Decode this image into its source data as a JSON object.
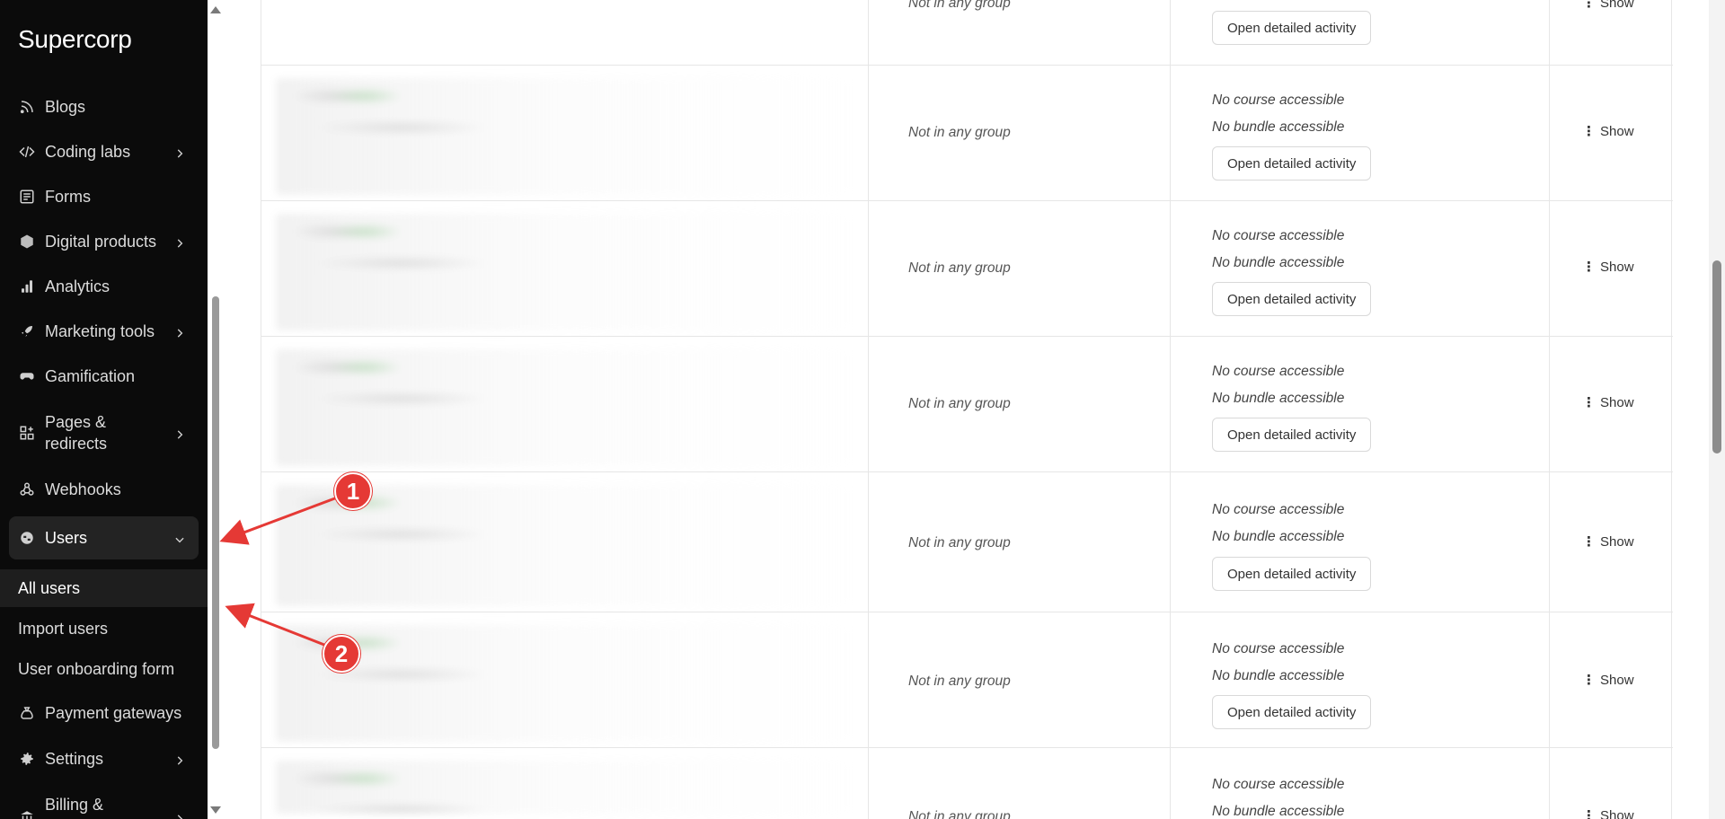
{
  "sidebar": {
    "brand": "Supercorp",
    "items": [
      {
        "label": "Blogs",
        "icon": "rss-icon",
        "has_chevron": false
      },
      {
        "label": "Coding labs",
        "icon": "code-icon",
        "has_chevron": true
      },
      {
        "label": "Forms",
        "icon": "form-icon",
        "has_chevron": false
      },
      {
        "label": "Digital products",
        "icon": "box-icon",
        "has_chevron": true
      },
      {
        "label": "Analytics",
        "icon": "bar-chart-icon",
        "has_chevron": false
      },
      {
        "label": "Marketing tools",
        "icon": "rocket-icon",
        "has_chevron": true
      },
      {
        "label": "Gamification",
        "icon": "gamepad-icon",
        "has_chevron": false
      },
      {
        "label": "Pages & redirects",
        "icon": "grid-plus-icon",
        "has_chevron": true
      },
      {
        "label": "Webhooks",
        "icon": "webhook-icon",
        "has_chevron": false
      },
      {
        "label": "Users",
        "icon": "users-globe-icon",
        "has_chevron": true,
        "expanded": true
      }
    ],
    "users_sub": [
      "All users",
      "Import users",
      "User onboarding form"
    ],
    "after_items": [
      {
        "label": "Payment gateways",
        "icon": "money-bag-icon",
        "has_chevron": false
      },
      {
        "label": "Settings",
        "icon": "gear-icon",
        "has_chevron": true
      },
      {
        "label": "Billing &",
        "icon": "bank-icon",
        "has_chevron": true
      }
    ]
  },
  "table": {
    "rows": [
      {
        "group": "Not in any group",
        "course": "",
        "bundle": "",
        "activity_button": "Open detailed activity",
        "action": "Show"
      },
      {
        "group": "Not in any group",
        "course": "No course accessible",
        "bundle": "No bundle accessible",
        "activity_button": "Open detailed activity",
        "action": "Show"
      },
      {
        "group": "Not in any group",
        "course": "No course accessible",
        "bundle": "No bundle accessible",
        "activity_button": "Open detailed activity",
        "action": "Show"
      },
      {
        "group": "Not in any group",
        "course": "No course accessible",
        "bundle": "No bundle accessible",
        "activity_button": "Open detailed activity",
        "action": "Show"
      },
      {
        "group": "Not in any group",
        "course": "No course accessible",
        "bundle": "No bundle accessible",
        "activity_button": "Open detailed activity",
        "action": "Show"
      },
      {
        "group": "Not in any group",
        "course": "No course accessible",
        "bundle": "No bundle accessible",
        "activity_button": "Open detailed activity",
        "action": "Show"
      },
      {
        "group": "Not in any group",
        "course": "No course accessible",
        "bundle": "No bundle accessible",
        "activity_button": "",
        "action": "Show"
      }
    ]
  },
  "annotations": {
    "marker_1": "1",
    "marker_2": "2",
    "color": "#e53935"
  },
  "colors": {
    "sidebar_bg": "#0b0b0b",
    "active_bg": "#232323"
  }
}
